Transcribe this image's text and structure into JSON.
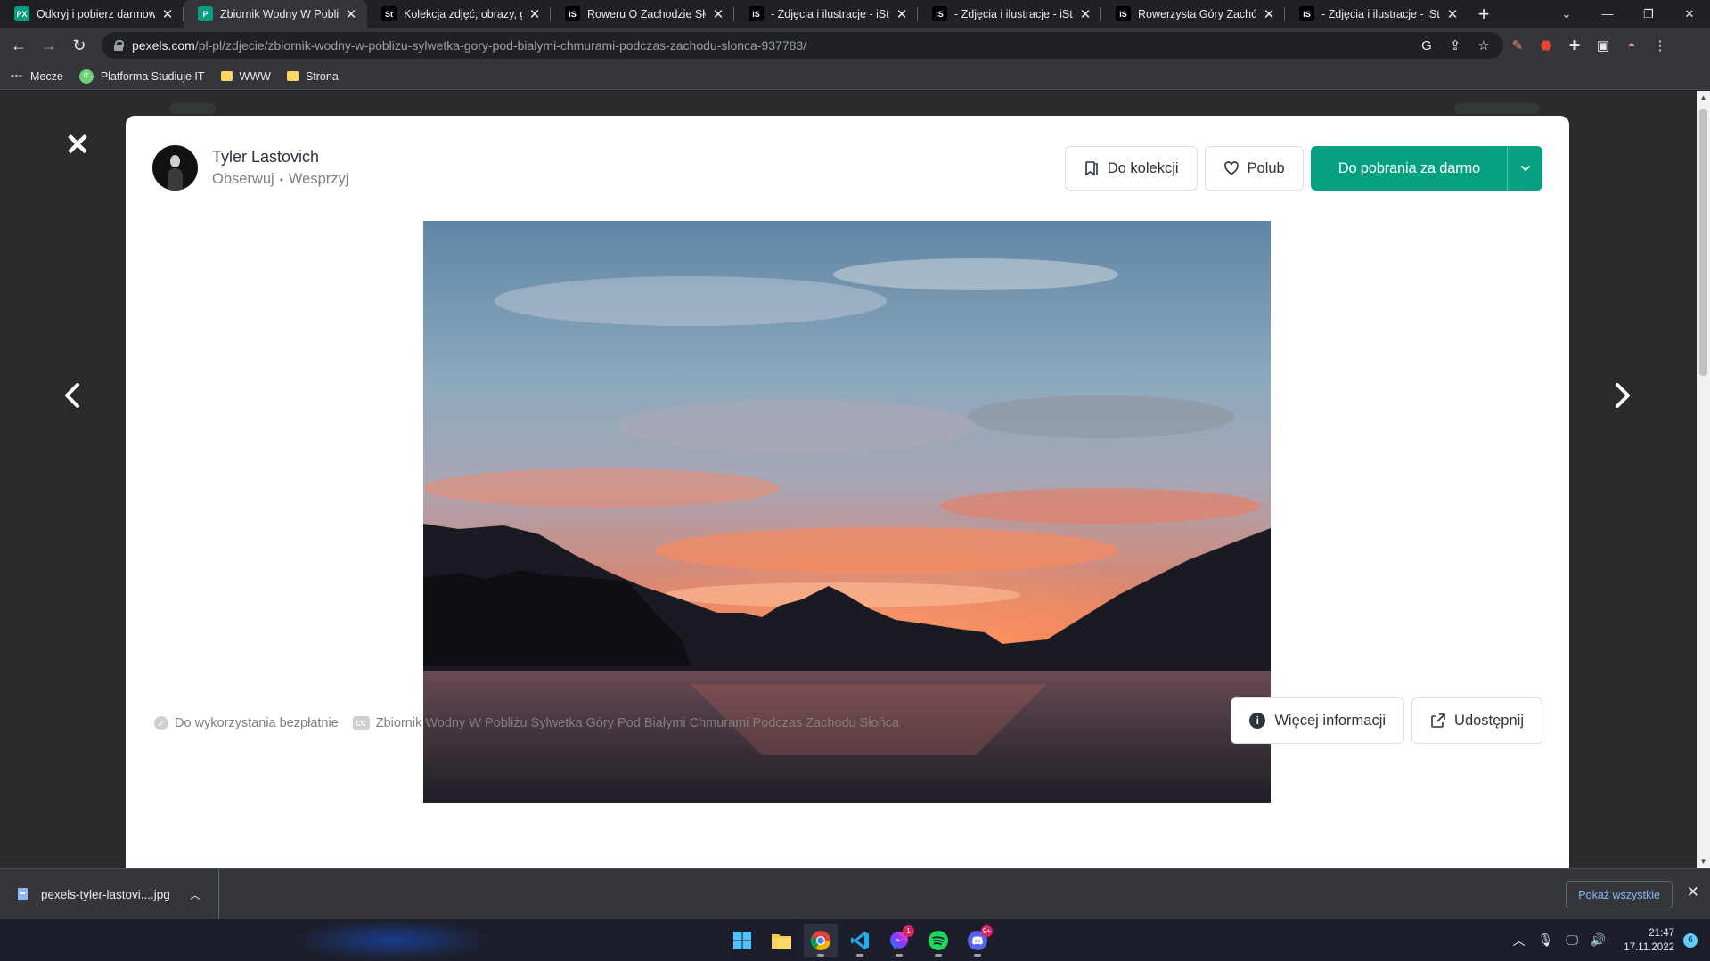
{
  "browser": {
    "tabs": [
      {
        "title": "Odkryj i pobierz darmowe",
        "favicon": "pexels-icon",
        "favicon_text": "PX",
        "favicon_color": "#05a081",
        "active": false
      },
      {
        "title": "Zbiornik Wodny W Pobliżu",
        "favicon": "pexels-icon",
        "favicon_text": "P",
        "favicon_color": "#05a081",
        "active": true
      },
      {
        "title": "Kolekcja zdjęć; obrazy, gra",
        "favicon": "stock-icon",
        "favicon_text": "St",
        "favicon_color": "#000000",
        "active": false
      },
      {
        "title": "Roweru O Zachodzie Słońca",
        "favicon": "istock-icon",
        "favicon_text": "iS",
        "favicon_color": "#000000",
        "active": false
      },
      {
        "title": "- Zdjęcia i ilustracje - iStoc",
        "favicon": "istock-icon",
        "favicon_text": "iS",
        "favicon_color": "#000000",
        "active": false
      },
      {
        "title": "- Zdjęcia i ilustracje - iStoc",
        "favicon": "istock-icon",
        "favicon_text": "iS",
        "favicon_color": "#000000",
        "active": false
      },
      {
        "title": "Rowerzysta Góry Zachód -",
        "favicon": "istock-icon",
        "favicon_text": "iS",
        "favicon_color": "#000000",
        "active": false
      },
      {
        "title": "- Zdjęcia i ilustracje - iStoc",
        "favicon": "istock-icon",
        "favicon_text": "iS",
        "favicon_color": "#000000",
        "active": false
      }
    ],
    "url_host": "pexels.com",
    "url_path": "/pl-pl/zdjecie/zbiornik-wodny-w-poblizu-sylwetka-gory-pod-bialymi-chmurami-podczas-zachodu-slonca-937783/",
    "bookmarks": [
      {
        "label": "Mecze",
        "icon": "dots-icon"
      },
      {
        "label": "Platforma Studiuje IT",
        "icon": "ptit-icon"
      },
      {
        "label": "WWW",
        "icon": "folder-icon"
      },
      {
        "label": "Strona",
        "icon": "folder-icon"
      }
    ]
  },
  "photo_page": {
    "author_name": "Tyler Lastovich",
    "follow": "Obserwuj",
    "separator": "•",
    "support": "Wesprzyj",
    "collect_label": "Do kolekcji",
    "like_label": "Polub",
    "download_label": "Do pobrania za darmo",
    "free_label": "Do wykorzystania bezpłatnie",
    "photo_title": "Zbiornik Wodny W Pobliżu Sylwetka Góry Pod Białymi Chmurami Podczas Zachodu Słońca",
    "more_info_label": "Więcej informacji",
    "share_label": "Udostępnij",
    "accent_color": "#05a081"
  },
  "download_shelf": {
    "file_name": "pexels-tyler-lastovi....jpg",
    "show_all": "Pokaż wszystkie"
  },
  "taskbar": {
    "apps": [
      "windows-start-icon",
      "file-explorer-icon",
      "chrome-icon",
      "vscode-icon",
      "messenger-icon",
      "spotify-icon",
      "discord-icon"
    ],
    "messenger_badge": "1",
    "discord_badge": "9+",
    "time": "21:47",
    "date": "17.11.2022",
    "notifications": "6"
  }
}
